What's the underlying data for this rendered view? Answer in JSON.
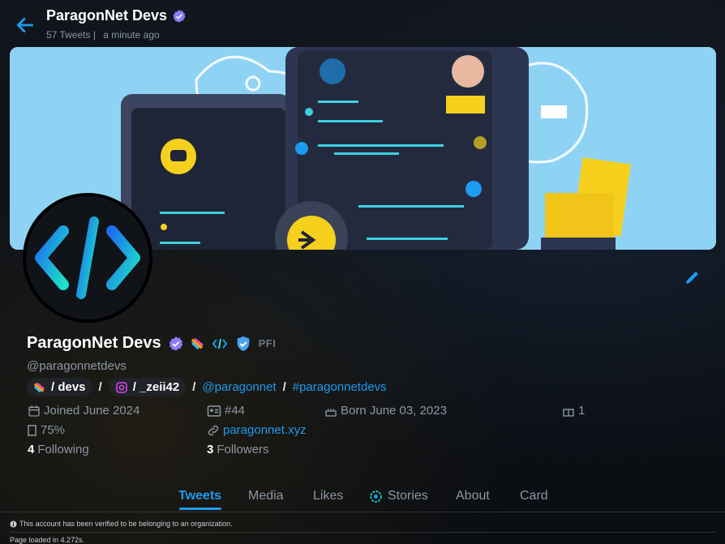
{
  "header": {
    "name": "ParagonNet Devs",
    "tweet_count": "57 Tweets |",
    "last_active": "a minute ago"
  },
  "profile": {
    "display_name": "ParagonNet Devs",
    "badge_text": "PFI",
    "handle": "@paragonnetdevs",
    "links": {
      "devs_label": "/ devs",
      "separator": "/",
      "instagram_label": "/ _zeii42",
      "mention": "@paragonnet",
      "hashtag": "#paragonnetdevs"
    },
    "joined": "Joined June 2024",
    "id_number": "#44",
    "born": "Born June 03, 2023",
    "gift_count": "1",
    "percent": "75%",
    "website": "paragonnet.xyz",
    "following_count": "4",
    "following_label": "Following",
    "followers_count": "3",
    "followers_label": "Followers"
  },
  "tabs": [
    {
      "label": "Tweets",
      "active": true
    },
    {
      "label": "Media"
    },
    {
      "label": "Likes"
    },
    {
      "label": "Stories"
    },
    {
      "label": "About"
    },
    {
      "label": "Card"
    }
  ],
  "footer": {
    "verified_note": "This account has been verified to be belonging to an organization.",
    "load_time": "Page loaded in 4.272s."
  },
  "colors": {
    "accent": "#1d9bf0",
    "verified_purple": "#8b7cf6",
    "verified_blue": "#1d9bf0"
  },
  "icons": [
    "back-arrow-icon",
    "verified-badge-icon",
    "pride-flag-icon",
    "code-icon",
    "shield-check-icon",
    "instagram-icon",
    "calendar-icon",
    "id-card-icon",
    "cake-icon",
    "gift-icon",
    "link-icon",
    "edit-pencil-icon",
    "stories-icon",
    "info-icon"
  ]
}
